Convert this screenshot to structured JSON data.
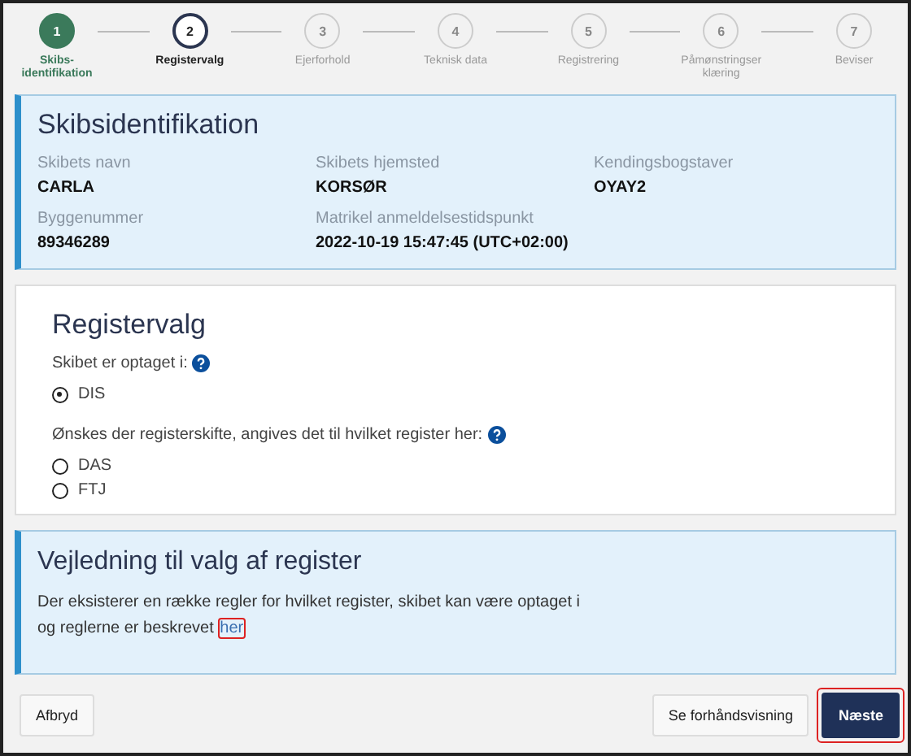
{
  "steps": [
    {
      "number": "1",
      "label": "Skibs-identifikation",
      "completed": true,
      "selected": false
    },
    {
      "number": "2",
      "label": "Registervalg",
      "completed": false,
      "selected": true
    },
    {
      "number": "3",
      "label": "Ejerforhold",
      "completed": false,
      "selected": false
    },
    {
      "number": "4",
      "label": "Teknisk data",
      "completed": false,
      "selected": false
    },
    {
      "number": "5",
      "label": "Registrering",
      "completed": false,
      "selected": false
    },
    {
      "number": "6",
      "label": "Påmønstringser klæring",
      "completed": false,
      "selected": false
    },
    {
      "number": "7",
      "label": "Beviser",
      "completed": false,
      "selected": false
    }
  ],
  "ship_card": {
    "title": "Skibsidentifikation",
    "fields": [
      {
        "label": "Skibets navn",
        "value": "CARLA"
      },
      {
        "label": "Skibets hjemsted",
        "value": "KORSØR"
      },
      {
        "label": "Kendingsbogstaver",
        "value": "OYAY2"
      },
      {
        "label": "Byggenummer",
        "value": "89346289"
      },
      {
        "label": "Matrikel anmeldelsestidspunkt",
        "value": "2022-10-19 15:47:45 (UTC+02:00)"
      }
    ]
  },
  "register_card": {
    "title": "Registervalg",
    "groups": [
      {
        "question": "Skibet er optaget i:",
        "options": [
          {
            "label": "DIS",
            "selected": true
          }
        ]
      },
      {
        "question": "Ønskes der registerskifte, angives det til hvilket register her:",
        "options": [
          {
            "label": "DAS",
            "selected": false
          },
          {
            "label": "FTJ",
            "selected": false
          }
        ]
      }
    ]
  },
  "guide_card": {
    "title": "Vejledning til valg af register",
    "text": "Der eksisterer en række regler for hvilket register, skibet kan være optaget i og reglerne er beskrevet",
    "link": {
      "label": "her",
      "highlighted": true
    }
  },
  "footer": {
    "cancel": {
      "label": "Afbryd"
    },
    "preview": {
      "label": "Se forhåndsvisning"
    },
    "next": {
      "label": "Næste",
      "highlighted": true
    }
  }
}
